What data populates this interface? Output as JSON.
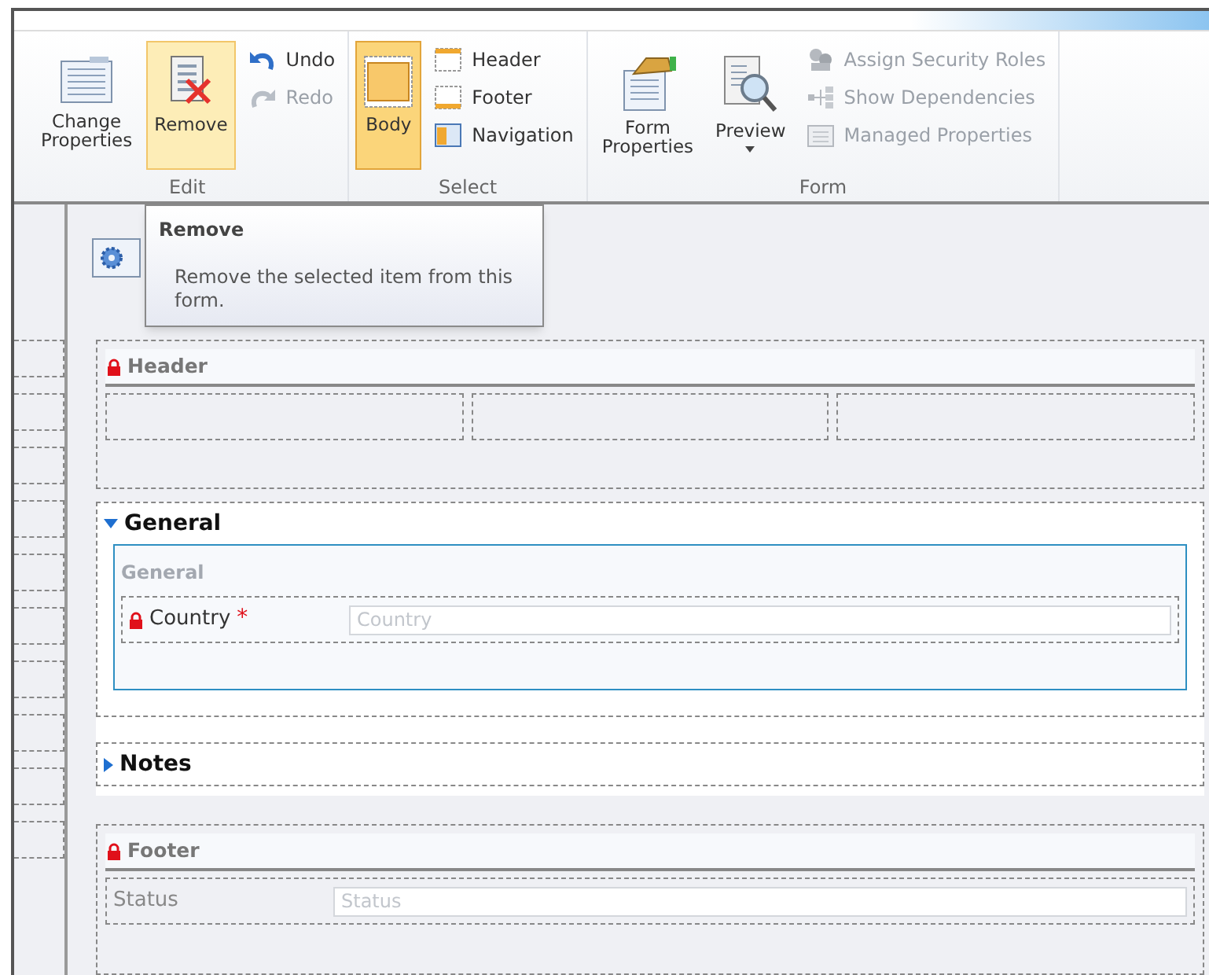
{
  "ribbon": {
    "groups": [
      {
        "label": "Edit",
        "items": [
          {
            "kind": "large",
            "label": "Change Properties",
            "selected": false,
            "hovered": false,
            "disabled": false
          },
          {
            "kind": "large",
            "label": "Remove",
            "selected": false,
            "hovered": true,
            "disabled": false
          },
          {
            "kind": "small",
            "label": "Undo",
            "disabled": false
          },
          {
            "kind": "small",
            "label": "Redo",
            "disabled": true
          }
        ]
      },
      {
        "label": "Select",
        "items": [
          {
            "kind": "large",
            "label": "Body",
            "selected": true,
            "hovered": false,
            "disabled": false
          },
          {
            "kind": "small",
            "label": "Header",
            "disabled": false
          },
          {
            "kind": "small",
            "label": "Footer",
            "disabled": false
          },
          {
            "kind": "small",
            "label": "Navigation",
            "disabled": false
          }
        ]
      },
      {
        "label": "Form",
        "items": [
          {
            "kind": "large",
            "label": "Form Properties",
            "selected": false,
            "hovered": false,
            "disabled": false,
            "has_menu": false
          },
          {
            "kind": "large",
            "label": "Preview",
            "selected": false,
            "hovered": false,
            "disabled": false,
            "has_menu": true
          },
          {
            "kind": "small",
            "label": "Assign Security Roles",
            "disabled": true
          },
          {
            "kind": "small",
            "label": "Show Dependencies",
            "disabled": true
          },
          {
            "kind": "small",
            "label": "Managed Properties",
            "disabled": true
          }
        ]
      }
    ]
  },
  "tooltip": {
    "title": "Remove",
    "text": "Remove the selected item from this form."
  },
  "form": {
    "header": {
      "title": "Header",
      "locked": true
    },
    "tabs": [
      {
        "title": "General",
        "expanded": true,
        "sections": [
          {
            "title": "General",
            "fields": [
              {
                "label": "Country",
                "locked": true,
                "required_mark": "*",
                "placeholder": "Country"
              }
            ]
          }
        ]
      },
      {
        "title": "Notes",
        "expanded": false
      }
    ],
    "footer": {
      "title": "Footer",
      "locked": true,
      "fields": [
        {
          "label": "Status",
          "locked": false,
          "placeholder": "Status"
        }
      ]
    }
  }
}
